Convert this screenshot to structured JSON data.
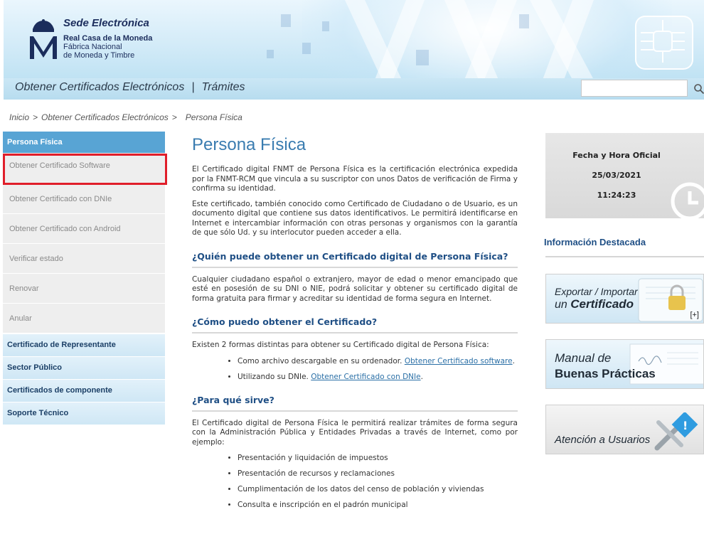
{
  "header": {
    "title": "Sede Electrónica",
    "org_line1": "Real Casa de la Moneda",
    "org_line2": "Fábrica Nacional",
    "org_line3": "de Moneda y Timbre"
  },
  "nav": {
    "link1": "Obtener Certificados Electrónicos",
    "separator": "|",
    "link2": "Trámites",
    "search_placeholder": ""
  },
  "breadcrumb": {
    "home": "Inicio",
    "separator": ">",
    "level1": "Obtener Certificados Electrónicos",
    "current": "Persona Física"
  },
  "sidebar": {
    "heading": "Persona Física",
    "items": [
      "Obtener Certificado Software",
      "Obtener Certificado con DNIe",
      "Obtener Certificado con Android",
      "Verificar estado",
      "Renovar",
      "Anular"
    ],
    "categories": [
      "Certificado de Representante",
      "Sector Público",
      "Certificados de componente",
      "Soporte Técnico"
    ]
  },
  "main": {
    "title": "Persona Física",
    "p1": "El Certificado digital FNMT de Persona Física es la certificación electrónica expedida por la FNMT-RCM que vincula a su suscriptor con unos Datos de verificación de Firma y confirma su identidad.",
    "p2": "Este certificado, también conocido como Certificado de Ciudadano o de Usuario, es un documento digital que contiene sus datos identificativos. Le permitirá identificarse en Internet e intercambiar información con otras personas y organismos con la garantía de que sólo Ud. y su interlocutor pueden acceder a ella.",
    "h2_1": "¿Quién puede obtener un Certificado digital de Persona Física?",
    "p3": "Cualquier ciudadano español o extranjero, mayor de edad o menor emancipado que esté en posesión de su DNI o NIE, podrá solicitar y obtener su certificado digital de forma gratuita para firmar y acreditar su identidad de forma segura en Internet.",
    "h2_2": "¿Cómo puedo obtener el Certificado?",
    "p4": "Existen 2 formas distintas para obtener su Certificado digital de Persona Física:",
    "way1_text": "Como archivo descargable en su ordenador.",
    "way1_link": "Obtener Certificado software",
    "way2_text": "Utilizando su DNIe.",
    "way2_link": "Obtener Certificado con DNIe",
    "h2_3": "¿Para qué sirve?",
    "p5": "El Certificado digital de Persona Física le permitirá realizar trámites de forma segura con la Administración Pública y Entidades Privadas a través de Internet, como por ejemplo:",
    "uses": [
      "Presentación y liquidación de impuestos",
      "Presentación de recursos y reclamaciones",
      "Cumplimentación de los datos del censo de población y viviendas",
      "Consulta e inscripción en el padrón municipal"
    ]
  },
  "right": {
    "clock_title": "Fecha y Hora Oficial",
    "date": "25/03/2021",
    "time": "11:24:23",
    "info_title": "Información Destacada",
    "promo1_line1": "Exportar / Importar",
    "promo1_prefix": "un",
    "promo1_bold": "Certificado",
    "promo1_plus": "[+]",
    "promo2_line1": "Manual de",
    "promo2_bold": "Buenas Prácticas",
    "promo3_line1": "Atención a Usuarios"
  }
}
